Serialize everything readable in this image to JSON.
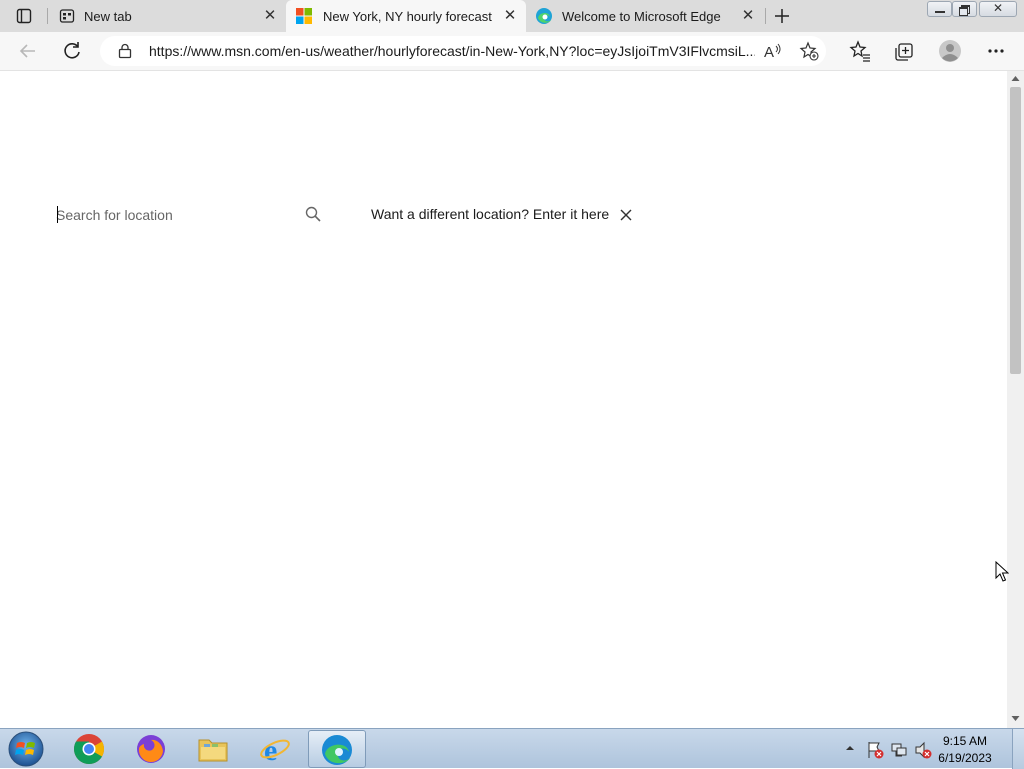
{
  "tabs": [
    {
      "label": "New tab",
      "icon": "new-tab-icon"
    },
    {
      "label": "New York, NY hourly forecast | M",
      "icon": "microsoft-logo-icon",
      "active": true
    },
    {
      "label": "Welcome to Microsoft Edge",
      "icon": "edge-icon"
    }
  ],
  "address_bar": {
    "url": "https://www.msn.com/en-us/weather/hourlyforecast/in-New-York,NY?loc=eyJsIjoiTmV3IFlvcmsiL..."
  },
  "search": {
    "placeholder": "Search for location",
    "prompt": "Want a different location? Enter it here"
  },
  "taskbar": {
    "apps": [
      "start-orb",
      "chrome",
      "firefox",
      "file-explorer",
      "internet-explorer",
      "edge"
    ],
    "time": "9:15 AM",
    "date": "6/19/2023"
  },
  "colors": {
    "tabstrip": "#dcdcdc",
    "active_tab": "#f7f7f7",
    "taskbar": "#bcd0e6"
  }
}
